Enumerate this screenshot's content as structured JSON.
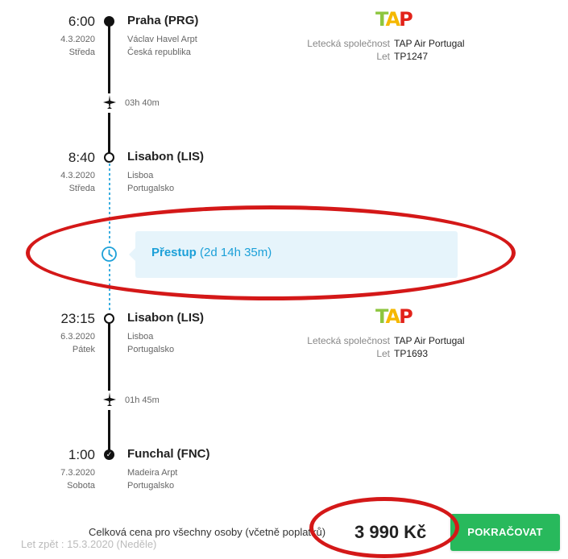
{
  "segments": [
    {
      "dep_time": "6:00",
      "dep_date": "4.3.2020",
      "dep_day": "Středa",
      "dep_city": "Praha (PRG)",
      "dep_airport": "Václav Havel Arpt",
      "dep_country": "Česká republika",
      "duration": "03h 40m",
      "arr_time": "8:40",
      "arr_date": "4.3.2020",
      "arr_day": "Středa",
      "arr_city": "Lisabon (LIS)",
      "arr_airport": "Lisboa",
      "arr_country": "Portugalsko",
      "airline_label": "Letecká společnost",
      "airline": "TAP Air Portugal",
      "flight_label": "Let",
      "flight": "TP1247"
    },
    {
      "dep_time": "23:15",
      "dep_date": "6.3.2020",
      "dep_day": "Pátek",
      "dep_city": "Lisabon (LIS)",
      "dep_airport": "Lisboa",
      "dep_country": "Portugalsko",
      "duration": "01h 45m",
      "arr_time": "1:00",
      "arr_date": "7.3.2020",
      "arr_day": "Sobota",
      "arr_city": "Funchal (FNC)",
      "arr_airport": "Madeira Arpt",
      "arr_country": "Portugalsko",
      "airline_label": "Letecká společnost",
      "airline": "TAP Air Portugal",
      "flight_label": "Let",
      "flight": "TP1693"
    }
  ],
  "layover": {
    "label": "Přestup",
    "duration": "(2d 14h 35m)"
  },
  "airline_logo": {
    "text_t": "T",
    "text_a": "A",
    "text_p": "P",
    "green": "#8dc63f",
    "red": "#e2231a",
    "yellow": "#f5b800"
  },
  "footer": {
    "return_text": "Let zpět : 15.3.2020 (Neděle)",
    "total_label": "Celková cena pro všechny osoby (včetně poplatků)",
    "total_price": "3 990 Kč",
    "continue_button": "POKRAČOVAT"
  },
  "colors": {
    "accent": "#1ca0d8",
    "button": "#28b95c",
    "annotation": "#d41818"
  }
}
